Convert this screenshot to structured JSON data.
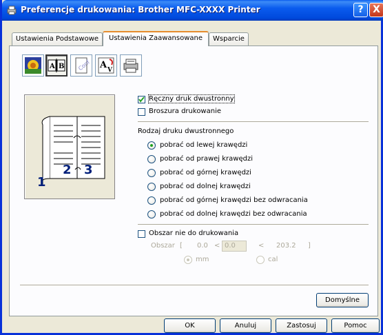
{
  "window": {
    "title": "Preferencje drukowania: Brother MFC-XXXX Printer",
    "help_glyph": "?",
    "close_glyph": "X"
  },
  "tabs": [
    {
      "label": "Ustawienia Podstawowe"
    },
    {
      "label": "Ustawienia Zaawansowane"
    },
    {
      "label": "Wsparcie"
    }
  ],
  "toolbar_icons": [
    "color-icon",
    "duplex-icon",
    "watermark-icon",
    "page-setting-icon",
    "device-options-icon"
  ],
  "preview": {
    "page_numbers": [
      "1",
      "2",
      "3"
    ]
  },
  "options": {
    "manual_duplex": {
      "label": "Ręczny druk dwustronny",
      "checked": true
    },
    "booklet": {
      "label": "Broszura drukowanie",
      "checked": false
    }
  },
  "duplex_type": {
    "heading": "Rodzaj druku dwustronnego",
    "choices": [
      {
        "label": "pobrać od lewej krawędzi",
        "selected": true
      },
      {
        "label": "pobrać od  prawej krawędzi",
        "selected": false
      },
      {
        "label": "pobrać od  górnej krawędzi",
        "selected": false
      },
      {
        "label": "pobrać od  dolnej krawędzi",
        "selected": false
      },
      {
        "label": "pobrać od  górnej krawędzi bez odwracania",
        "selected": false
      },
      {
        "label": "pobrać od  dolnej krawędzi bez odwracania",
        "selected": false
      }
    ]
  },
  "binding_offset": {
    "label": "Obszar nie do drukowania",
    "checked": false,
    "field_label": "Obszar",
    "bracket_open": "[",
    "min": "0.0",
    "lt1": "<",
    "value": "0.0",
    "lt2": "<",
    "max": "203.2",
    "bracket_close": "]",
    "unit_mm": "mm",
    "unit_cal": "cal",
    "unit_selected": "mm"
  },
  "buttons": {
    "default": "Domyślne",
    "ok": "OK",
    "cancel": "Anuluj",
    "apply": "Zastosuj",
    "help": "Pomoc"
  }
}
